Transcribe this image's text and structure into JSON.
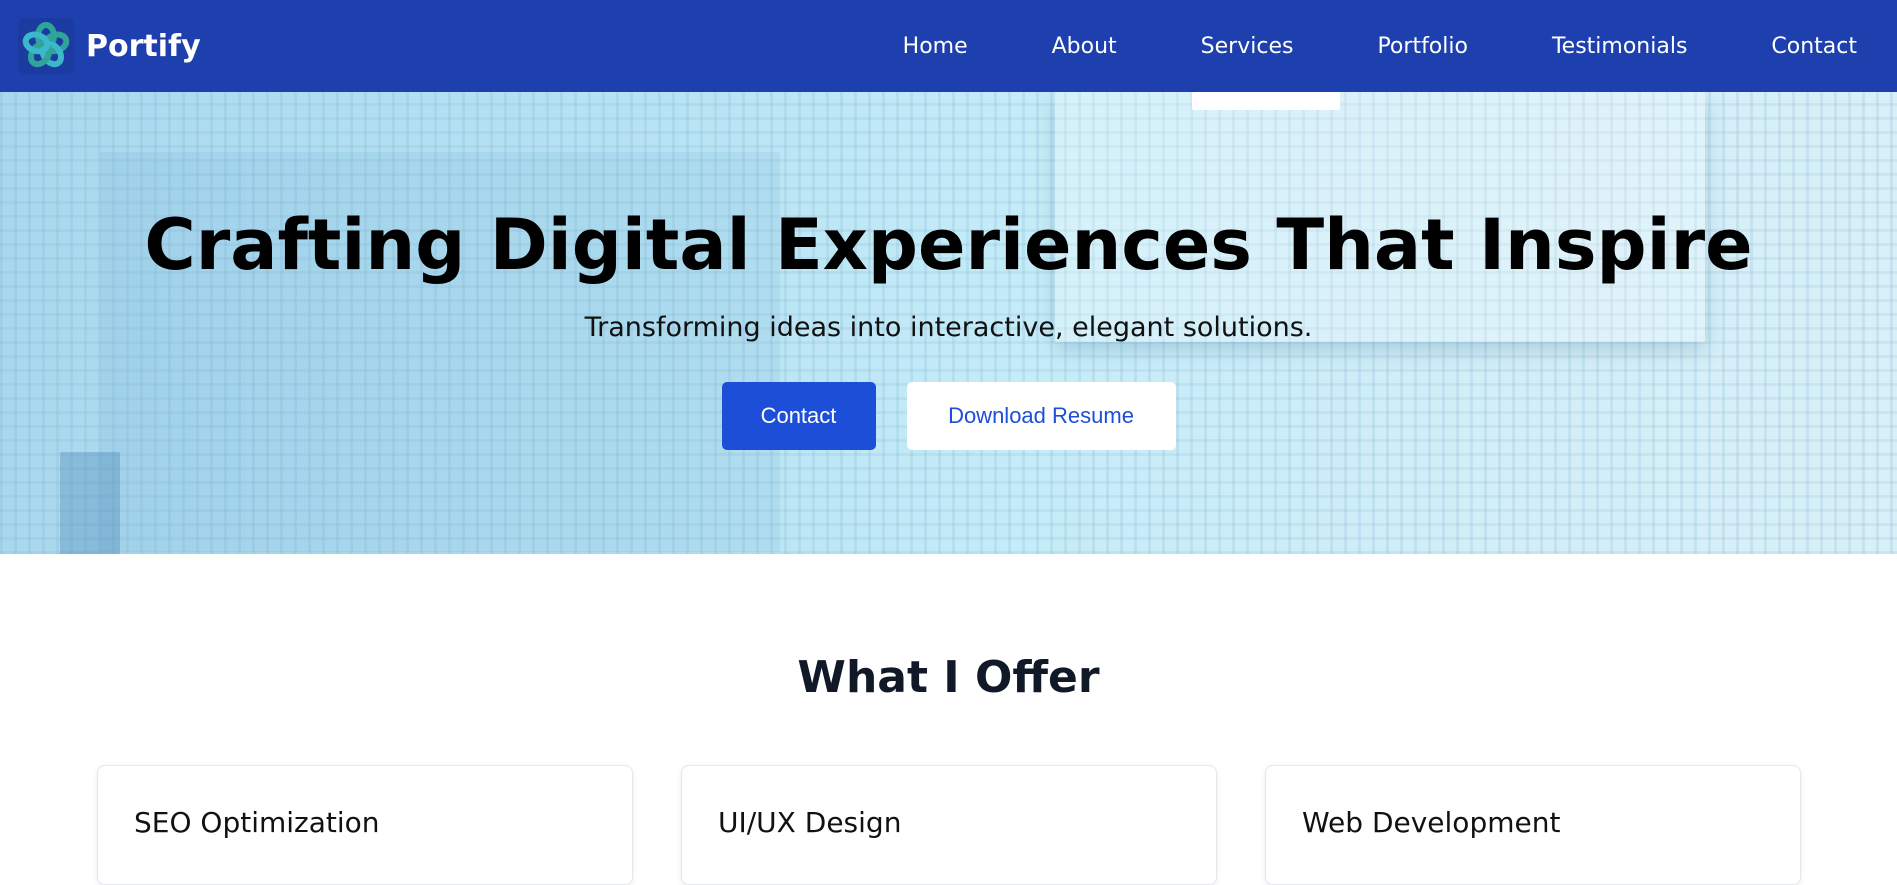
{
  "nav": {
    "brand": "Portify",
    "links": [
      "Home",
      "About",
      "Services",
      "Portfolio",
      "Testimonials",
      "Contact"
    ]
  },
  "hero": {
    "title": "Crafting Digital Experiences That Inspire",
    "subtitle": "Transforming ideas into interactive, elegant solutions.",
    "primary_button": "Contact",
    "secondary_button": "Download Resume"
  },
  "services": {
    "heading": "What I Offer",
    "cards": [
      {
        "title": "SEO Optimization"
      },
      {
        "title": "UI/UX Design"
      },
      {
        "title": "Web Development"
      }
    ]
  }
}
